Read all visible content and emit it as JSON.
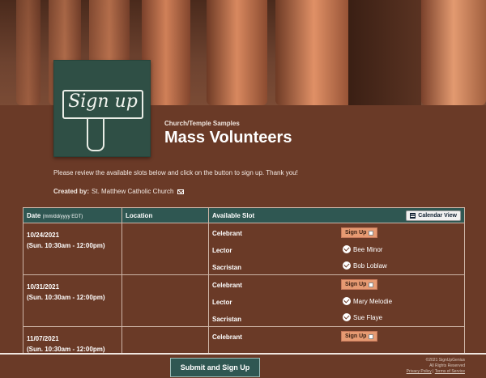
{
  "header": {
    "kicker": "Church/Temple Samples",
    "title": "Mass Volunteers"
  },
  "intro": "Please review the available slots below and click on the button to sign up. Thank you!",
  "created_by": {
    "label": "Created by:",
    "name": "St. Matthew Catholic Church"
  },
  "logo_text": "Sign up",
  "table": {
    "headers": {
      "date": "Date",
      "date_format": "(mm/dd/yyyy EDT)",
      "location": "Location",
      "slot": "Available Slot",
      "calendar_button": "Calendar View"
    },
    "signup_label": "Sign Up",
    "rows": [
      {
        "date": "10/24/2021",
        "time": "(Sun. 10:30am - 12:00pm)",
        "location": "",
        "slots": [
          "Celebrant",
          "Lector",
          "Sacristan"
        ],
        "volunteers": [
          "Bee Minor",
          "Bob Loblaw"
        ]
      },
      {
        "date": "10/31/2021",
        "time": "(Sun. 10:30am - 12:00pm)",
        "location": "",
        "slots": [
          "Celebrant",
          "Lector",
          "Sacristan"
        ],
        "volunteers": [
          "Mary Melodie",
          "Sue Flaye"
        ]
      },
      {
        "date": "11/07/2021",
        "time": "(Sun. 10:30am - 12:00pm)",
        "location": "",
        "slots": [
          "Celebrant"
        ],
        "volunteers": []
      }
    ]
  },
  "footer": {
    "submit": "Submit and Sign Up",
    "copyright": "©2021 SignUpGenius",
    "rights": "All Rights Reserved",
    "privacy": "Privacy Policy",
    "terms": "Terms of Service"
  }
}
